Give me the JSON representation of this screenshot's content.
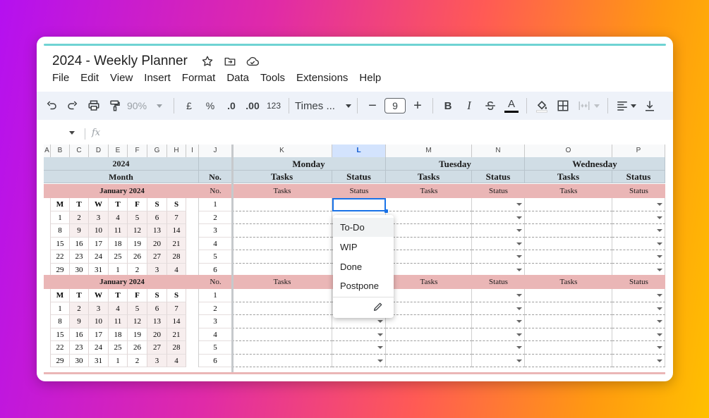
{
  "doc": {
    "title": "2024 - Weekly Planner"
  },
  "menu": [
    "File",
    "Edit",
    "View",
    "Insert",
    "Format",
    "Data",
    "Tools",
    "Extensions",
    "Help"
  ],
  "toolbar": {
    "zoom": "90%",
    "currency": "£",
    "percent": "%",
    "dec_decrease": ".0",
    "dec_increase": ".00",
    "number_format": "123",
    "font": "Times ...",
    "font_size": "9",
    "bold": "B",
    "italic": "I",
    "text_color": "A"
  },
  "formula": {
    "fx": "fx"
  },
  "columns": [
    "A",
    "B",
    "C",
    "D",
    "E",
    "F",
    "G",
    "H",
    "I",
    "J",
    "K",
    "L",
    "M",
    "N",
    "O",
    "P"
  ],
  "grid": {
    "year": "2024",
    "month_label": "Month",
    "no_label": "No.",
    "days": [
      "Monday",
      "Tuesday",
      "Wednesday"
    ],
    "tasks_label": "Tasks",
    "status_label": "Status",
    "weekdays": [
      "M",
      "T",
      "W",
      "T",
      "F",
      "S",
      "S"
    ],
    "blocks": [
      {
        "month": "January 2024",
        "weeks": [
          [
            "1",
            "2",
            "3",
            "4",
            "5",
            "6",
            "7"
          ],
          [
            "8",
            "9",
            "10",
            "11",
            "12",
            "13",
            "14"
          ],
          [
            "15",
            "16",
            "17",
            "18",
            "19",
            "20",
            "21"
          ],
          [
            "22",
            "23",
            "24",
            "25",
            "26",
            "27",
            "28"
          ],
          [
            "29",
            "30",
            "31",
            "1",
            "2",
            "3",
            "4"
          ]
        ],
        "nums": [
          "1",
          "2",
          "3",
          "4",
          "5",
          "6"
        ]
      },
      {
        "month": "January 2024",
        "weeks": [
          [
            "1",
            "2",
            "3",
            "4",
            "5",
            "6",
            "7"
          ],
          [
            "8",
            "9",
            "10",
            "11",
            "12",
            "13",
            "14"
          ],
          [
            "15",
            "16",
            "17",
            "18",
            "19",
            "20",
            "21"
          ],
          [
            "22",
            "23",
            "24",
            "25",
            "26",
            "27",
            "28"
          ],
          [
            "29",
            "30",
            "31",
            "1",
            "2",
            "3",
            "4"
          ]
        ],
        "nums": [
          "1",
          "2",
          "3",
          "4",
          "5",
          "6"
        ]
      }
    ]
  },
  "dropdown": {
    "options": [
      "To-Do",
      "WIP",
      "Done",
      "Postpone"
    ]
  },
  "colors": {
    "header": "#d0dde5",
    "pink": "#eab6b6",
    "selection": "#1a73e8",
    "accent": "#6fd3d3"
  }
}
